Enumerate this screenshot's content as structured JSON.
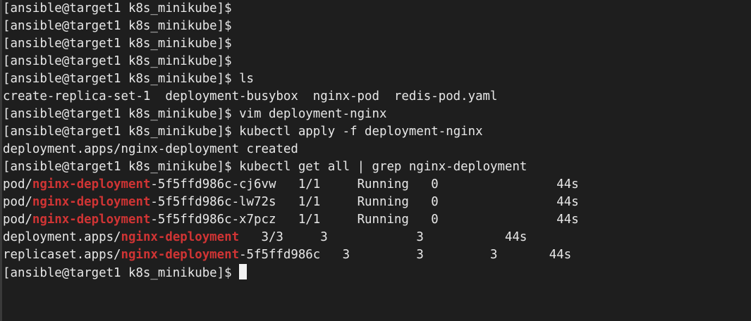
{
  "terminal": {
    "lines": [
      {
        "kind": "cmd",
        "prompt": "[ansible@target1 k8s_minikube]$",
        "cmd": ""
      },
      {
        "kind": "cmd",
        "prompt": "[ansible@target1 k8s_minikube]$",
        "cmd": ""
      },
      {
        "kind": "cmd",
        "prompt": "[ansible@target1 k8s_minikube]$",
        "cmd": ""
      },
      {
        "kind": "cmd",
        "prompt": "[ansible@target1 k8s_minikube]$",
        "cmd": ""
      },
      {
        "kind": "cmd",
        "prompt": "[ansible@target1 k8s_minikube]$",
        "cmd": "ls"
      },
      {
        "kind": "out",
        "text": "create-replica-set-1  deployment-busybox  nginx-pod  redis-pod.yaml"
      },
      {
        "kind": "cmd",
        "prompt": "[ansible@target1 k8s_minikube]$",
        "cmd": "vim deployment-nginx"
      },
      {
        "kind": "cmd",
        "prompt": "[ansible@target1 k8s_minikube]$",
        "cmd": "kubectl apply -f deployment-nginx"
      },
      {
        "kind": "out",
        "text": "deployment.apps/nginx-deployment created"
      },
      {
        "kind": "cmd",
        "prompt": "[ansible@target1 k8s_minikube]$",
        "cmd": "kubectl get all | grep nginx-deployment"
      },
      {
        "kind": "grep",
        "pre": "pod/",
        "match": "nginx-deployment",
        "post": "-5f5ffd986c-cj6vw   1/1     Running   0                44s"
      },
      {
        "kind": "grep",
        "pre": "pod/",
        "match": "nginx-deployment",
        "post": "-5f5ffd986c-lw72s   1/1     Running   0                44s"
      },
      {
        "kind": "grep",
        "pre": "pod/",
        "match": "nginx-deployment",
        "post": "-5f5ffd986c-x7pcz   1/1     Running   0                44s"
      },
      {
        "kind": "grep",
        "pre": "deployment.apps/",
        "match": "nginx-deployment",
        "post": "   3/3     3            3           44s"
      },
      {
        "kind": "grep",
        "pre": "replicaset.apps/",
        "match": "nginx-deployment",
        "post": "-5f5ffd986c   3         3         3       44s"
      },
      {
        "kind": "cmd-cursor",
        "prompt": "[ansible@target1 k8s_minikube]$",
        "cmd": ""
      }
    ],
    "colors": {
      "background": "#1e1e1e",
      "foreground": "#e8e8e8",
      "grep_match": "#d03434",
      "cursor": "#f2f2f2"
    }
  }
}
